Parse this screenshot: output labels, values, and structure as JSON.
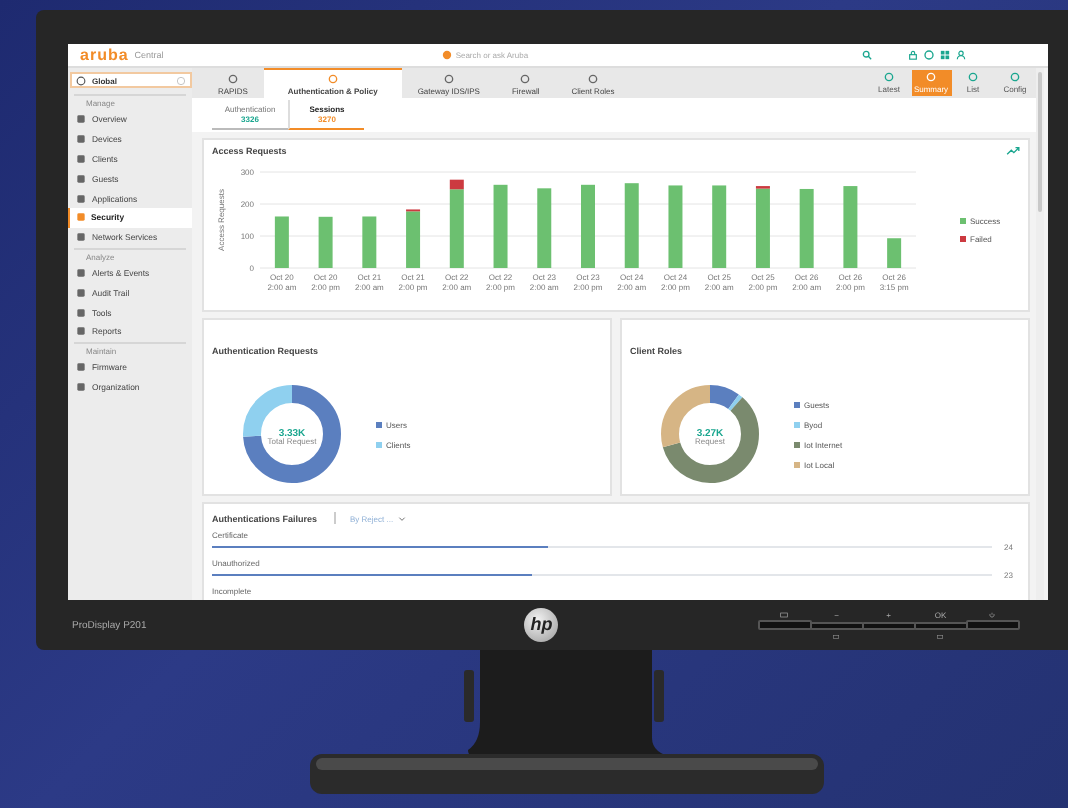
{
  "monitor": {
    "model": "ProDisplay P201",
    "logo": "hp",
    "front_buttons": [
      {
        "kind": "menu"
      },
      {
        "kind": "text",
        "label": "−"
      },
      {
        "kind": "text",
        "label": "+"
      },
      {
        "kind": "text",
        "label": "OK"
      },
      {
        "kind": "power"
      }
    ]
  },
  "app": {
    "logo": "aruba",
    "product": "Central",
    "search": {
      "placeholder": "Search or ask Aruba"
    }
  },
  "sidebar": {
    "scope": "Global",
    "sections": [
      {
        "heading": "Manage",
        "items": [
          {
            "label": "Overview",
            "selected": false
          },
          {
            "label": "Devices",
            "selected": false
          },
          {
            "label": "Clients",
            "selected": false
          },
          {
            "label": "Guests",
            "selected": false
          },
          {
            "label": "Applications",
            "selected": false
          },
          {
            "label": "Security",
            "selected": true
          },
          {
            "label": "Network Services",
            "selected": false
          }
        ]
      },
      {
        "heading": "Analyze",
        "items": [
          {
            "label": "Alerts & Events",
            "selected": false
          },
          {
            "label": "Audit Trail",
            "selected": false
          },
          {
            "label": "Tools",
            "selected": false
          },
          {
            "label": "Reports",
            "selected": false
          }
        ]
      },
      {
        "heading": "Maintain",
        "items": [
          {
            "label": "Firmware",
            "selected": false
          },
          {
            "label": "Organization",
            "selected": false
          }
        ]
      }
    ]
  },
  "tabs": [
    {
      "label": "RAPIDS",
      "selected": false
    },
    {
      "label": "Authentication & Policy",
      "selected": true
    },
    {
      "label": "Gateway IDS/IPS",
      "selected": false
    },
    {
      "label": "Firewall",
      "selected": false
    },
    {
      "label": "Client Roles",
      "selected": false
    }
  ],
  "view_buttons": [
    {
      "label": "Latest",
      "selected": false
    },
    {
      "label": "Summary",
      "selected": true
    },
    {
      "label": "List",
      "selected": false
    },
    {
      "label": "Config",
      "selected": false
    }
  ],
  "subtabs": [
    {
      "label": "Authentication",
      "count": "3326",
      "selected": false
    },
    {
      "label": "Sessions",
      "count": "3270",
      "selected": true
    }
  ],
  "access_requests": {
    "chart_data": {
      "type": "bar",
      "title": "Access Requests",
      "ylabel": "Access Requests",
      "stacked": true,
      "ylim": [
        0,
        300
      ],
      "yticks": [
        0,
        100,
        200,
        300
      ],
      "categories": [
        "Oct 20 2:00 am",
        "Oct 20 2:00 pm",
        "Oct 21 2:00 am",
        "Oct 21 2:00 pm",
        "Oct 22 2:00 am",
        "Oct 22 2:00 pm",
        "Oct 23 2:00 am",
        "Oct 23 2:00 pm",
        "Oct 24 2:00 am",
        "Oct 24 2:00 pm",
        "Oct 25 2:00 am",
        "Oct 25 2:00 pm",
        "Oct 26 2:00 am",
        "Oct 26 2:00 pm",
        "Oct 26 3:15 pm"
      ],
      "series": [
        {
          "name": "Success",
          "color": "#6cc070",
          "values": [
            161,
            160,
            161,
            177,
            246,
            260,
            249,
            260,
            265,
            258,
            258,
            248,
            247,
            256,
            93
          ]
        },
        {
          "name": "Failed",
          "color": "#cc3a40",
          "values": [
            0,
            0,
            0,
            6,
            30,
            0,
            0,
            0,
            0,
            0,
            0,
            8,
            0,
            0,
            0
          ]
        }
      ]
    }
  },
  "auth_requests": {
    "title": "Authentication Requests",
    "total": "3.33K",
    "total_label": "Total Request",
    "legend": [
      {
        "label": "Users",
        "color": "#5b7fbf"
      },
      {
        "label": "Clients",
        "color": "#8fd0ef"
      }
    ]
  },
  "client_roles": {
    "title": "Client Roles",
    "total": "3.27K",
    "total_label": "Request",
    "legend": [
      {
        "label": "Guests",
        "color": "#5b7fbf"
      },
      {
        "label": "Byod",
        "color": "#8fd0ef"
      },
      {
        "label": "Iot Internet",
        "color": "#7a8a6e"
      },
      {
        "label": "Iot Local",
        "color": "#d6b585"
      }
    ]
  },
  "failures": {
    "title": "Authentications Failures",
    "filter": "By Reject ...",
    "rows": [
      {
        "label": "Certificate",
        "level": 0.43,
        "count": "24"
      },
      {
        "label": "Unauthorized",
        "level": 0.41,
        "count": "23"
      },
      {
        "label": "Incomplete"
      }
    ]
  }
}
